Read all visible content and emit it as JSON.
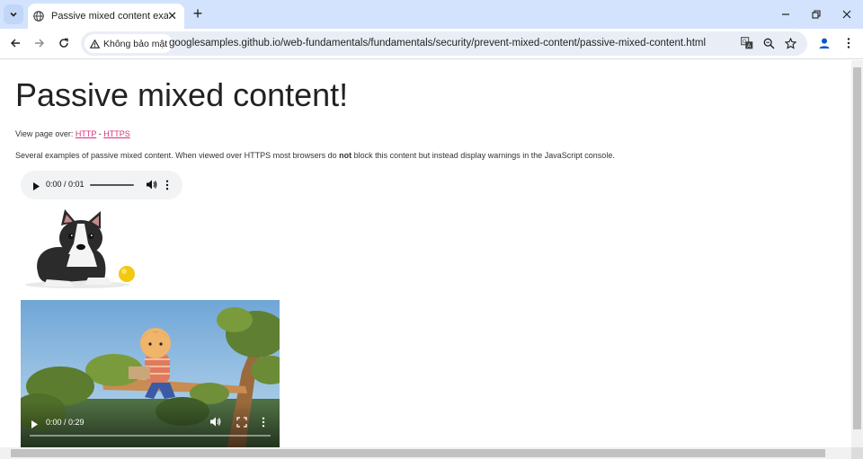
{
  "tab": {
    "title": "Passive mixed content example",
    "close": "✕"
  },
  "new_tab": "+",
  "security": {
    "label": "Không bảo mật"
  },
  "url": "googlesamples.github.io/web-fundamentals/fundamentals/security/prevent-mixed-content/passive-mixed-content.html",
  "page": {
    "heading": "Passive mixed content!",
    "view_over_prefix": "View page over: ",
    "http_link": "HTTP",
    "separator": " - ",
    "https_link": "HTTPS",
    "desc_before": "Several examples of passive mixed content. When viewed over HTTPS most browsers do ",
    "desc_bold": "not",
    "desc_after": " block this content but instead display warnings in the JavaScript console."
  },
  "audio": {
    "time": "0:00 / 0:01"
  },
  "video": {
    "time": "0:00 / 0:29"
  },
  "colors": {
    "link": "#d9307a",
    "tabbar": "#d3e3fd",
    "omnibox": "#e9eef6"
  },
  "icons": [
    "tab-search-icon",
    "favicon-icon",
    "back-icon",
    "forward-icon",
    "reload-icon",
    "warning-icon",
    "translate-icon",
    "zoom-icon",
    "star-icon",
    "profile-icon",
    "menu-icon",
    "play-icon",
    "volume-icon",
    "more-icon",
    "fullscreen-icon"
  ]
}
